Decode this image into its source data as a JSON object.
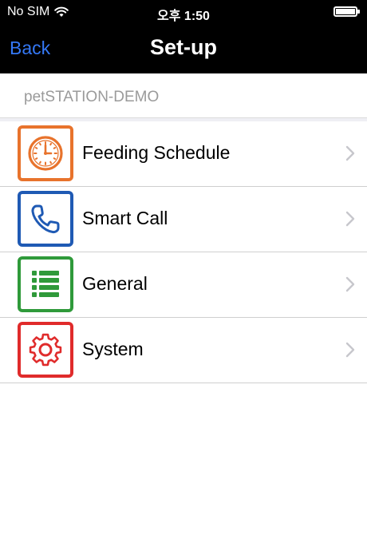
{
  "status_bar": {
    "carrier": "No SIM",
    "time": "오후 1:50",
    "battery_level": 1.0
  },
  "nav": {
    "back_label": "Back",
    "title": "Set-up"
  },
  "device": {
    "name": "petSTATION-DEMO"
  },
  "menu": {
    "items": [
      {
        "label": "Feeding Schedule",
        "icon": "clock-icon",
        "color": "#e8732c"
      },
      {
        "label": "Smart Call",
        "icon": "phone-icon",
        "color": "#1f5ab4"
      },
      {
        "label": "General",
        "icon": "list-icon",
        "color": "#2f9a3a"
      },
      {
        "label": "System",
        "icon": "gear-icon",
        "color": "#e02b2b"
      }
    ]
  },
  "colors": {
    "nav_background": "#000000",
    "back_link": "#3478f6",
    "device_text": "#9a9a9a"
  }
}
